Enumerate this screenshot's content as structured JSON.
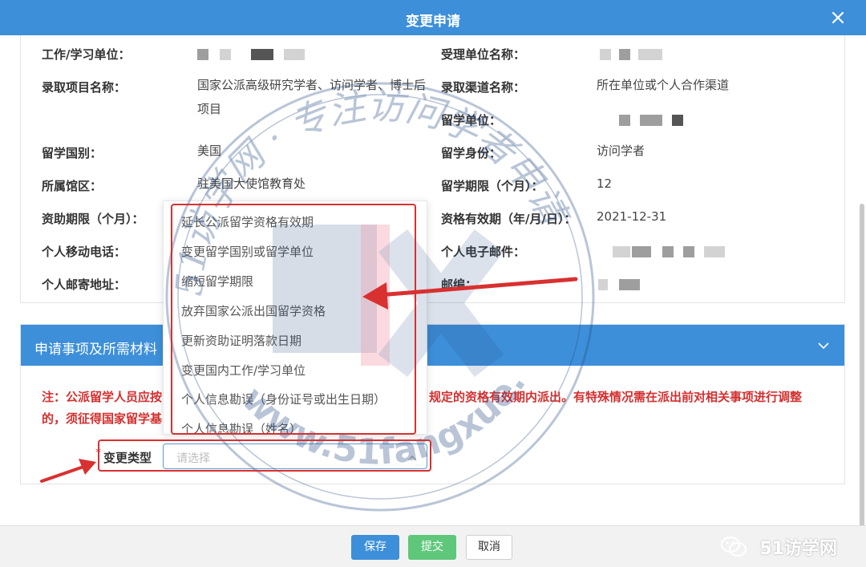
{
  "dialog": {
    "title": "变更申请"
  },
  "info": {
    "work_unit_label": "工作/学习单位：",
    "receiving_unit_label": "受理单位名称：",
    "project_label": "录取项目名称：",
    "project_value": "国家公派高级研究学者、访问学者、博士后项目",
    "channel_label": "录取渠道名称：",
    "channel_value": "所在单位或个人合作渠道",
    "study_unit_label": "留学单位：",
    "country_label": "留学国别：",
    "country_value": "美国",
    "identity_label": "留学身份：",
    "identity_value": "访问学者",
    "embassy_label": "所属馆区：",
    "embassy_value": "驻美国大使馆教育处",
    "period_label": "留学期限（个月）：",
    "period_value": "12",
    "funding_label": "资助期限（个月）：",
    "validity_label": "资格有效期（年/月/日）：",
    "validity_value": "2021-12-31",
    "phone_label": "个人移动电话：",
    "email_label": "个人电子邮件：",
    "address_label": "个人邮寄地址：",
    "postcode_label": "邮编："
  },
  "section": {
    "title": "申请事项及所需材料",
    "note_line1_left": "注：公派留学人员应按",
    "note_line1_right": "规定的资格有效期内派出。有特殊情况需在派出前对相关事项进行调整",
    "note_line2_left": "的，须征得国家留学基",
    "change_type_label": "变更类型",
    "required_mark": "*",
    "select_placeholder": "请选择"
  },
  "dropdown": {
    "options": [
      "延长公派留学资格有效期",
      "变更留学国别或留学单位",
      "缩短留学期限",
      "放弃国家公派出国留学资格",
      "更新资助证明落款日期",
      "变更国内工作/学习单位",
      "个人信息勘误（身份证号或出生日期）",
      "个人信息勘误（姓名）"
    ]
  },
  "footer": {
    "save_label": "保存",
    "submit_label": "提交",
    "cancel_label": "取消",
    "brand": "51访学网"
  },
  "watermark": {
    "arc_text": "51访学网 · 专注访问学者申请",
    "bottom_text": "www.51fangxue.com",
    "logo_text": "FX"
  },
  "colors": {
    "primary": "#3d8fd9",
    "submit": "#5fc77a",
    "note_red": "#d32f2f",
    "annotation_red": "#d93030"
  }
}
